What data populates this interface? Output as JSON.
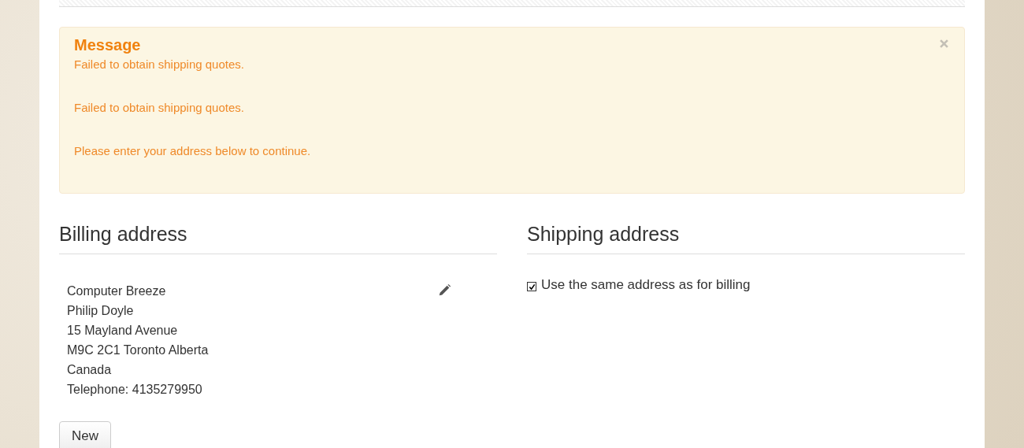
{
  "message": {
    "title": "Message",
    "lines": [
      "Failed to obtain shipping quotes.",
      "Failed to obtain shipping quotes.",
      "Please enter your address below to continue."
    ]
  },
  "billing": {
    "heading": "Billing address",
    "lines": [
      "Computer Breeze",
      "Philip Doyle",
      "15 Mayland Avenue",
      "M9C 2C1 Toronto Alberta",
      "Canada",
      "Telephone: 4135279950"
    ],
    "button": "New"
  },
  "shipping": {
    "heading": "Shipping address",
    "same_as_billing": {
      "label": "Use the same address as for billing",
      "checked": true
    }
  }
}
